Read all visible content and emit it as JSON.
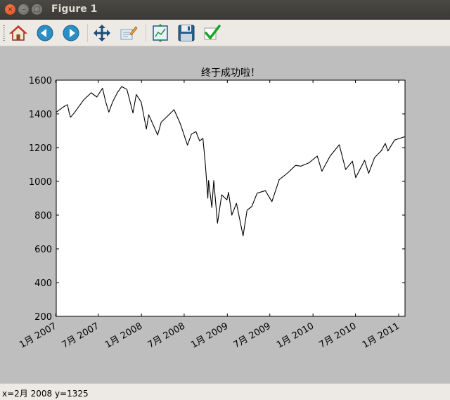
{
  "window": {
    "title": "Figure 1",
    "close_glyph": "×",
    "min_glyph": "–",
    "max_glyph": "□"
  },
  "toolbar": {
    "buttons": [
      {
        "name": "home-icon"
      },
      {
        "name": "back-icon"
      },
      {
        "name": "forward-icon"
      },
      {
        "name": "pan-icon"
      },
      {
        "name": "zoom-icon"
      },
      {
        "name": "subplots-icon"
      },
      {
        "name": "save-icon"
      },
      {
        "name": "edit-icon"
      }
    ]
  },
  "chart_data": {
    "type": "line",
    "title": "终于成功啦！",
    "xlabel": "",
    "ylabel": "",
    "ylim": [
      200,
      1600
    ],
    "xlim": [
      "2007-01-03",
      "2011-01-28"
    ],
    "grid": false,
    "color": "#000000",
    "yticks": [
      200,
      400,
      600,
      800,
      1000,
      1200,
      1400,
      1600
    ],
    "xticks": [
      {
        "date": "2007-01-01",
        "label": "1月 2007"
      },
      {
        "date": "2007-07-01",
        "label": "7月 2007"
      },
      {
        "date": "2008-01-01",
        "label": "1月 2008"
      },
      {
        "date": "2008-07-01",
        "label": "7月 2008"
      },
      {
        "date": "2009-01-01",
        "label": "1月 2009"
      },
      {
        "date": "2009-07-01",
        "label": "7月 2009"
      },
      {
        "date": "2010-01-01",
        "label": "1月 2010"
      },
      {
        "date": "2010-07-01",
        "label": "7月 2010"
      },
      {
        "date": "2011-01-01",
        "label": "1月 2011"
      }
    ],
    "series": [
      {
        "points": [
          [
            "2007-01-03",
            1410
          ],
          [
            "2007-02-01",
            1440
          ],
          [
            "2007-02-20",
            1455
          ],
          [
            "2007-02-28",
            1400
          ],
          [
            "2007-03-05",
            1380
          ],
          [
            "2007-03-20",
            1405
          ],
          [
            "2007-04-10",
            1445
          ],
          [
            "2007-05-01",
            1485
          ],
          [
            "2007-06-01",
            1525
          ],
          [
            "2007-06-25",
            1500
          ],
          [
            "2007-07-19",
            1552
          ],
          [
            "2007-08-01",
            1475
          ],
          [
            "2007-08-15",
            1410
          ],
          [
            "2007-08-31",
            1470
          ],
          [
            "2007-09-20",
            1525
          ],
          [
            "2007-10-09",
            1562
          ],
          [
            "2007-10-31",
            1545
          ],
          [
            "2007-11-26",
            1405
          ],
          [
            "2007-12-10",
            1515
          ],
          [
            "2007-12-31",
            1470
          ],
          [
            "2008-01-22",
            1310
          ],
          [
            "2008-02-01",
            1395
          ],
          [
            "2008-03-10",
            1275
          ],
          [
            "2008-03-25",
            1350
          ],
          [
            "2008-05-19",
            1425
          ],
          [
            "2008-06-15",
            1340
          ],
          [
            "2008-07-15",
            1215
          ],
          [
            "2008-08-01",
            1280
          ],
          [
            "2008-08-20",
            1295
          ],
          [
            "2008-09-05",
            1240
          ],
          [
            "2008-09-19",
            1255
          ],
          [
            "2008-09-29",
            1105
          ],
          [
            "2008-10-10",
            900
          ],
          [
            "2008-10-13",
            1005
          ],
          [
            "2008-10-27",
            845
          ],
          [
            "2008-11-04",
            1005
          ],
          [
            "2008-11-20",
            752
          ],
          [
            "2008-12-08",
            920
          ],
          [
            "2008-12-30",
            890
          ],
          [
            "2009-01-06",
            935
          ],
          [
            "2009-01-20",
            800
          ],
          [
            "2009-02-09",
            870
          ],
          [
            "2009-03-09",
            677
          ],
          [
            "2009-03-26",
            830
          ],
          [
            "2009-04-15",
            850
          ],
          [
            "2009-05-08",
            930
          ],
          [
            "2009-06-12",
            945
          ],
          [
            "2009-07-10",
            880
          ],
          [
            "2009-08-10",
            1010
          ],
          [
            "2009-09-15",
            1050
          ],
          [
            "2009-10-19",
            1095
          ],
          [
            "2009-11-10",
            1090
          ],
          [
            "2009-12-15",
            1110
          ],
          [
            "2010-01-19",
            1150
          ],
          [
            "2010-02-08",
            1060
          ],
          [
            "2010-03-15",
            1150
          ],
          [
            "2010-04-23",
            1217
          ],
          [
            "2010-05-20",
            1070
          ],
          [
            "2010-06-18",
            1120
          ],
          [
            "2010-07-02",
            1022
          ],
          [
            "2010-08-09",
            1125
          ],
          [
            "2010-08-26",
            1047
          ],
          [
            "2010-09-20",
            1140
          ],
          [
            "2010-10-18",
            1180
          ],
          [
            "2010-11-05",
            1225
          ],
          [
            "2010-11-16",
            1180
          ],
          [
            "2010-12-15",
            1245
          ],
          [
            "2011-01-28",
            1265
          ]
        ]
      }
    ]
  },
  "status": {
    "text": "x=2月 2008 y=1325"
  }
}
